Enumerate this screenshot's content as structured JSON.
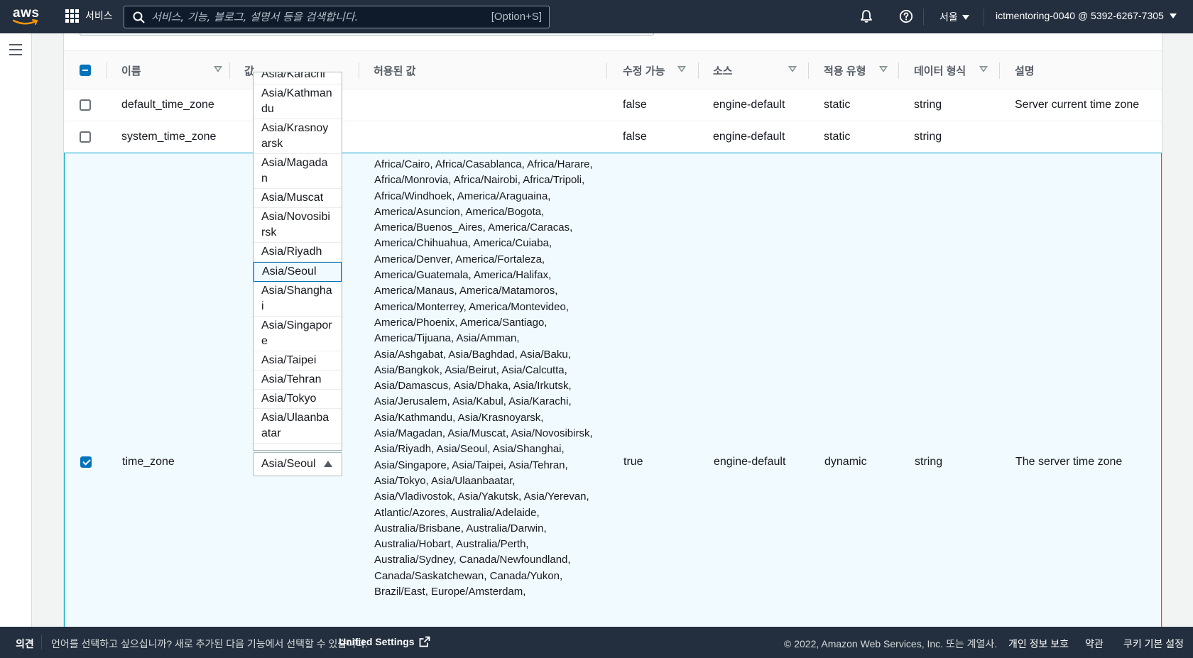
{
  "nav": {
    "logo": "aws",
    "services_label": "서비스",
    "search_placeholder": "서비스, 기능, 블로그, 설명서 등을 검색합니다.",
    "search_shortcut": "[Option+S]",
    "region": "서울",
    "account": "ictmentoring-0040 @ 5392-6267-7305"
  },
  "table": {
    "headers": {
      "name": "이름",
      "value": "값",
      "allowed": "허용된 값",
      "modifiable": "수정 가능",
      "source": "소스",
      "apply_type": "적용 유형",
      "data_type": "데이터 형식",
      "description": "설명"
    },
    "rows": [
      {
        "name": "default_time_zone",
        "modifiable": "false",
        "source": "engine-default",
        "apply_type": "static",
        "data_type": "string",
        "description": "Server current time zone"
      },
      {
        "name": "system_time_zone",
        "modifiable": "false",
        "source": "engine-default",
        "apply_type": "static",
        "data_type": "string",
        "description": ""
      },
      {
        "name": "time_zone",
        "value": "Asia/Seoul",
        "modifiable": "true",
        "source": "engine-default",
        "apply_type": "dynamic",
        "data_type": "string",
        "description": "The server time zone",
        "allowed": "Africa/Cairo, Africa/Casablanca, Africa/Harare, Africa/Monrovia, Africa/Nairobi, Africa/Tripoli, Africa/Windhoek, America/Araguaina, America/Asuncion, America/Bogota, America/Buenos_Aires, America/Caracas, America/Chihuahua, America/Cuiaba, America/Denver, America/Fortaleza, America/Guatemala, America/Halifax, America/Manaus, America/Matamoros, America/Monterrey, America/Montevideo, America/Phoenix, America/Santiago, America/Tijuana, Asia/Amman, Asia/Ashgabat, Asia/Baghdad, Asia/Baku, Asia/Bangkok, Asia/Beirut, Asia/Calcutta, Asia/Damascus, Asia/Dhaka, Asia/Irkutsk, Asia/Jerusalem, Asia/Kabul, Asia/Karachi, Asia/Kathmandu, Asia/Krasnoyarsk, Asia/Magadan, Asia/Muscat, Asia/Novosibirsk, Asia/Riyadh, Asia/Seoul, Asia/Shanghai, Asia/Singapore, Asia/Taipei, Asia/Tehran, Asia/Tokyo, Asia/Ulaanbaatar, Asia/Vladivostok, Asia/Yakutsk, Asia/Yerevan, Atlantic/Azores, Australia/Adelaide, Australia/Brisbane, Australia/Darwin, Australia/Hobart, Australia/Perth, Australia/Sydney, Canada/Newfoundland, Canada/Saskatchewan, Canada/Yukon, Brazil/East, Europe/Amsterdam,"
      }
    ]
  },
  "dropdown": {
    "options": [
      "Asia/Karachi",
      "Asia/Kathmandu",
      "Asia/Krasnoyarsk",
      "Asia/Magadan",
      "Asia/Muscat",
      "Asia/Novosibirsk",
      "Asia/Riyadh",
      "Asia/Seoul",
      "Asia/Shanghai",
      "Asia/Singapore",
      "Asia/Taipei",
      "Asia/Tehran",
      "Asia/Tokyo",
      "Asia/Ulaanbaatar"
    ],
    "selected": "Asia/Seoul"
  },
  "footer": {
    "feedback": "의견",
    "language_msg": "언어를 선택하고 싶으십니까? 새로 추가된 다음 기능에서 선택할 수 있습니다.",
    "unified_settings": "Unified Settings",
    "copyright": "© 2022, Amazon Web Services, Inc. 또는 계열사.",
    "privacy": "개인 정보 보호",
    "terms": "약관",
    "cookies": "쿠키 기본 설정"
  },
  "colors": {
    "nav_bg": "#232f3e",
    "accent": "#0073bb",
    "selected_row_bg": "#f1faff",
    "selected_border": "#00a1c9",
    "logo_smile": "#ff9900"
  }
}
